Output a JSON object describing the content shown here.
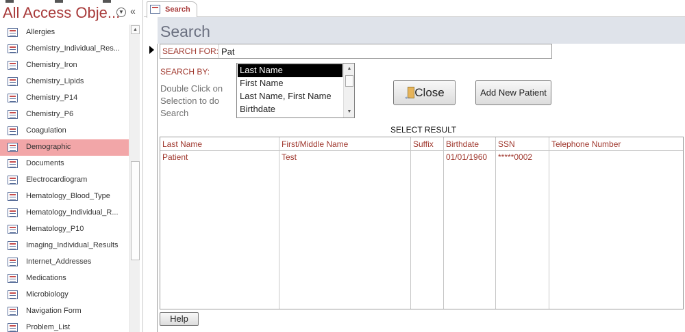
{
  "nav": {
    "title": "All Access Obje...",
    "items": [
      {
        "label": "Allergies"
      },
      {
        "label": "Chemistry_Individual_Res..."
      },
      {
        "label": "Chemistry_Iron"
      },
      {
        "label": "Chemistry_Lipids"
      },
      {
        "label": "Chemistry_P14"
      },
      {
        "label": "Chemistry_P6"
      },
      {
        "label": "Coagulation"
      },
      {
        "label": "Demographic",
        "selected": true
      },
      {
        "label": "Documents"
      },
      {
        "label": "Electrocardiogram"
      },
      {
        "label": "Hematology_Blood_Type"
      },
      {
        "label": "Hematology_Individual_R..."
      },
      {
        "label": "Hematology_P10"
      },
      {
        "label": "Imaging_Individual_Results"
      },
      {
        "label": "Internet_Addresses"
      },
      {
        "label": "Medications"
      },
      {
        "label": "Microbiology"
      },
      {
        "label": "Navigation Form"
      },
      {
        "label": "Problem_List"
      }
    ]
  },
  "tabs": [
    {
      "label": "Search"
    }
  ],
  "form": {
    "title": "Search",
    "search_for_label": "SEARCH FOR:",
    "search_for_value": "Pat",
    "search_by_label": "SEARCH BY:",
    "hint_lines": [
      "Double Click on",
      "Selection to do",
      "Search"
    ],
    "search_by_options": [
      "Last Name",
      "First Name",
      "Last Name, First Name",
      "Birthdate"
    ],
    "search_by_selected": "Last Name",
    "close_label": "Close",
    "add_new_patient_label": "Add New Patient",
    "select_result_label": "SELECT RESULT",
    "help_label": "Help"
  },
  "results": {
    "columns": [
      "Last Name",
      "First/Middle Name",
      "Suffix",
      "Birthdate",
      "SSN",
      "Telephone Number"
    ],
    "rows": [
      [
        "Patient",
        "Test",
        "",
        "01/01/1960",
        "*****0002",
        ""
      ]
    ]
  },
  "colors": {
    "label_red": "#a0392f",
    "nav_selected": "#f2a6a8",
    "header_band": "#dfe3ea"
  }
}
